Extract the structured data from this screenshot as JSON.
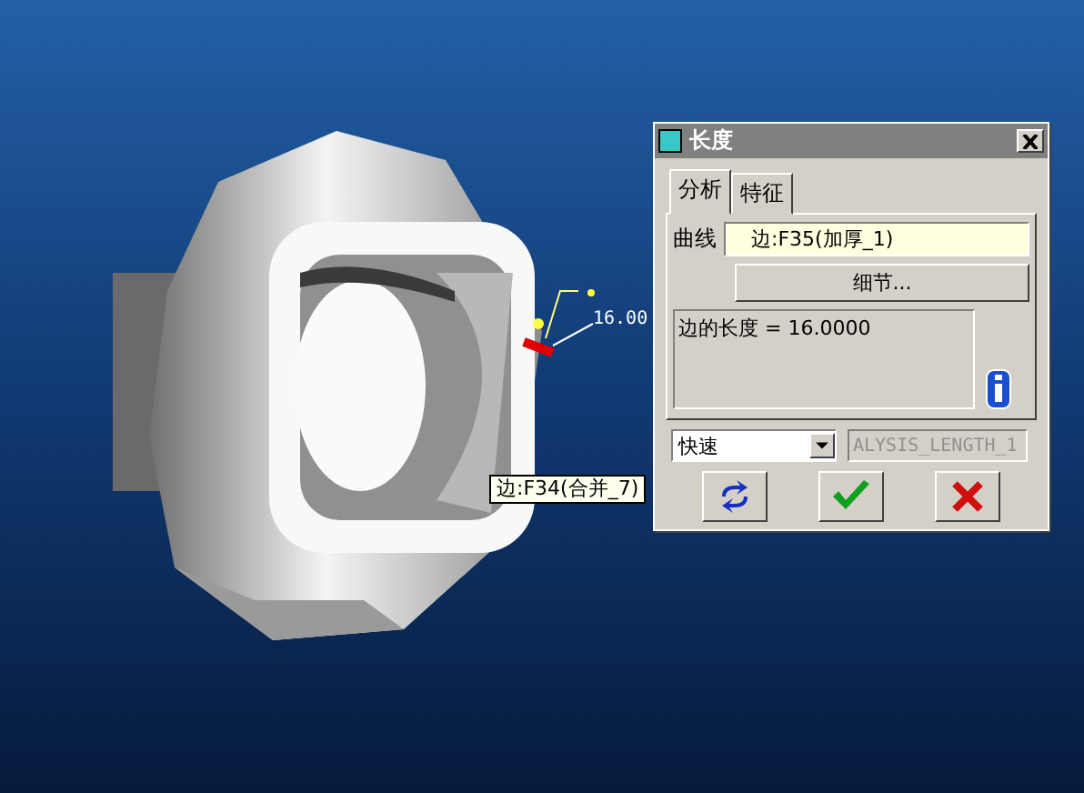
{
  "viewport": {
    "dimension_label": "16.00",
    "edge_tag": "边:F34(合并_7)"
  },
  "dialog": {
    "title": "长度",
    "tabs": [
      {
        "label": "分析",
        "selected": true
      },
      {
        "label": "特征",
        "selected": false
      }
    ],
    "curve": {
      "label": "曲线",
      "value": "边:F35(加厚_1)"
    },
    "details_button": "细节...",
    "result": "边的长度 = 16.0000",
    "mode": {
      "value": "快速"
    },
    "feature_name": {
      "value": "ALYSIS_LENGTH_1",
      "disabled": true
    },
    "buttons": [
      {
        "kind": "repeat"
      },
      {
        "kind": "ok"
      },
      {
        "kind": "cancel"
      }
    ]
  }
}
